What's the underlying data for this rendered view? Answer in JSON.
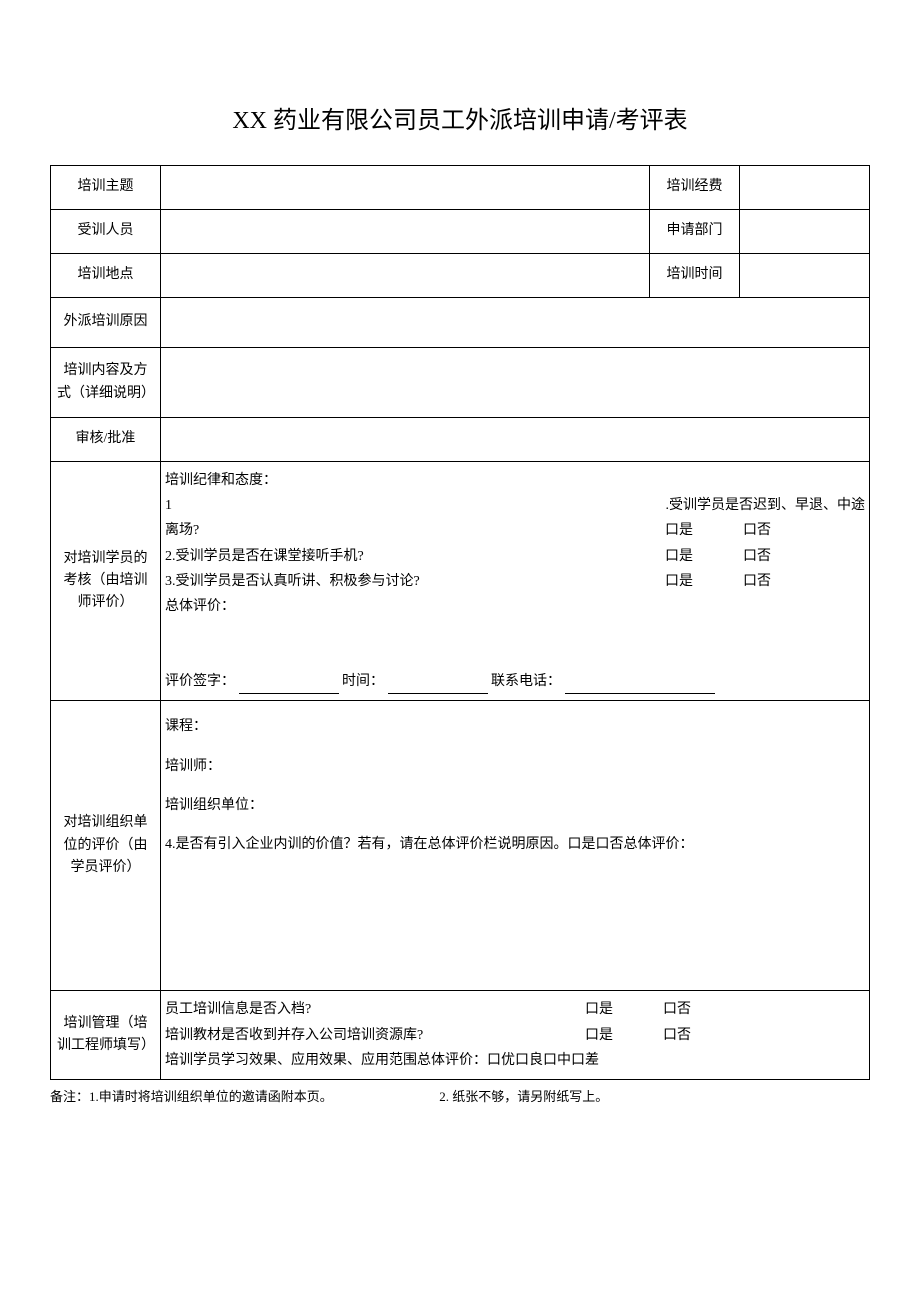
{
  "title": "XX 药业有限公司员工外派培训申请/考评表",
  "rows": {
    "topic_label": "培训主题",
    "fee_label": "培训经费",
    "trainee_label": "受训人员",
    "dept_label": "申请部门",
    "location_label": "培训地点",
    "time_label": "培训时间",
    "reason_label": "外派培训原因",
    "content_label": "培训内容及方式（详细说明）",
    "approve_label": "审核/批准"
  },
  "eval_trainer": {
    "label": "对培训学员的考核（由培训师评价）",
    "heading": "培训纪律和态度：",
    "q1_num": "1",
    "q1_text": ".受训学员是否迟到、早退、中途",
    "q1_line2": "离场?",
    "q2": "2.受训学员是否在课堂接听手机?",
    "q3": "3.受训学员是否认真听讲、积极参与讨论?",
    "yes": "口是",
    "no": "口否",
    "overall": "总体评价：",
    "sig_prefix": "评价签字：",
    "time_prefix": "时间：",
    "phone_prefix": "联系电话："
  },
  "eval_student": {
    "label": "对培训组织单位的评价（由学员评价）",
    "course": "课程：",
    "trainer": "培训师：",
    "org": "培训组织单位：",
    "q4": "4.是否有引入企业内训的价值？若有，请在总体评价栏说明原因。口是口否总体评价："
  },
  "mgmt": {
    "label": "培训管理（培训工程师填写）",
    "q1": "员工培训信息是否入档?",
    "q2": "培训教材是否收到并存入公司培训资源库?",
    "q3": "培训学员学习效果、应用效果、应用范围总体评价：口优口良口中口差",
    "yes": "口是",
    "no": "口否"
  },
  "footnote": {
    "part1": "备注：1.申请时将培训组织单位的邀请函附本页。",
    "part2": "2. 纸张不够，请另附纸写上。"
  }
}
